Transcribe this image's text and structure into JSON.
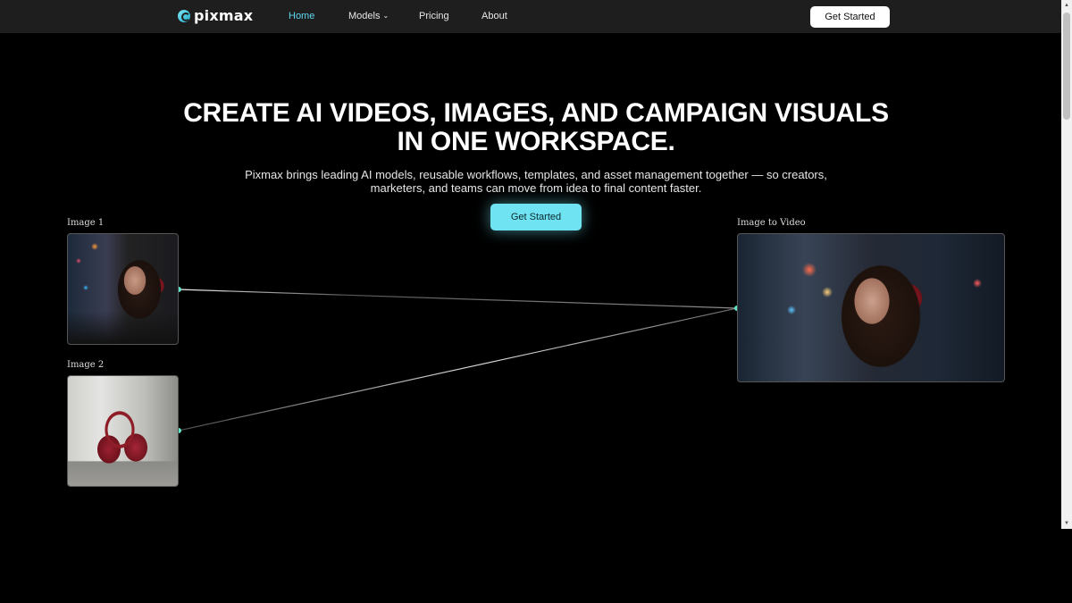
{
  "nav": {
    "logo_text": "pixmax",
    "links": [
      {
        "label": "Home",
        "active": true
      },
      {
        "label": "Models",
        "has_dropdown": true
      },
      {
        "label": "Pricing"
      },
      {
        "label": "About"
      }
    ],
    "cta_label": "Get Started"
  },
  "hero": {
    "title_line1": "CREATE AI VIDEOS, IMAGES, AND CAMPAIGN VISUALS",
    "title_line2": "IN ONE WORKSPACE.",
    "subtitle": "Pixmax brings leading AI models, reusable workflows, templates, and asset management together — so creators, marketers, and teams can move from idea to final content faster.",
    "cta_label": "Get Started"
  },
  "workflow": {
    "inputs": [
      {
        "label": "Image 1"
      },
      {
        "label": "Image 2"
      }
    ],
    "output": {
      "label": "Image to Video"
    }
  },
  "colors": {
    "accent": "#5fd6ee",
    "cta_bg": "#6fe3f2",
    "nav_bg": "#1e1e1e",
    "page_bg": "#000000"
  },
  "icons": [
    "pixmax-logo-icon",
    "chevron-down-icon",
    "connector-dot-icon"
  ]
}
